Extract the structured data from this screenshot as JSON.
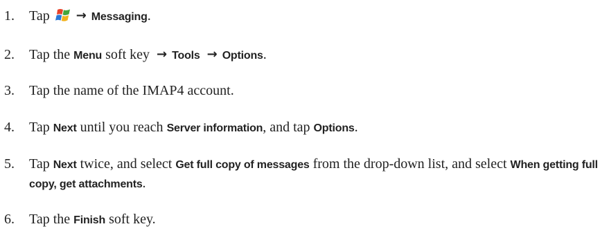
{
  "steps": [
    {
      "number": "1.",
      "parts": [
        {
          "t": "Tap ",
          "b": false
        },
        {
          "icon": "windows-start-icon"
        },
        {
          "arrow": "→"
        },
        {
          "t": "Messaging",
          "b": true
        },
        {
          "t": ".",
          "b": false
        }
      ]
    },
    {
      "number": "2.",
      "parts": [
        {
          "t": "Tap the ",
          "b": false
        },
        {
          "t": "Menu",
          "b": true
        },
        {
          "t": " soft key ",
          "b": false
        },
        {
          "arrow": "→"
        },
        {
          "t": "Tools",
          "b": true
        },
        {
          "t": " ",
          "b": false
        },
        {
          "arrow": "→"
        },
        {
          "t": "Options",
          "b": true
        },
        {
          "t": ".",
          "b": false
        }
      ]
    },
    {
      "number": "3.",
      "parts": [
        {
          "t": "Tap the name of the IMAP4 account.",
          "b": false
        }
      ]
    },
    {
      "number": "4.",
      "parts": [
        {
          "t": "Tap ",
          "b": false
        },
        {
          "t": "Next",
          "b": true
        },
        {
          "t": " until you reach ",
          "b": false
        },
        {
          "t": "Server information",
          "b": true
        },
        {
          "t": ", and tap ",
          "b": false
        },
        {
          "t": "Options",
          "b": true
        },
        {
          "t": ".",
          "b": false
        }
      ]
    },
    {
      "number": "5.",
      "parts": [
        {
          "t": "Tap ",
          "b": false
        },
        {
          "t": "Next",
          "b": true
        },
        {
          "t": " twice, and select ",
          "b": false
        },
        {
          "t": "Get full copy of messages",
          "b": true
        },
        {
          "t": " from the drop-down list, and select ",
          "b": false
        },
        {
          "t": "When getting full copy, get attachments",
          "b": true
        },
        {
          "t": ".",
          "b": false
        }
      ]
    },
    {
      "number": "6.",
      "parts": [
        {
          "t": "Tap the ",
          "b": false
        },
        {
          "t": "Finish",
          "b": true
        },
        {
          "t": " soft key.",
          "b": false
        }
      ]
    }
  ],
  "icons": {
    "start_icon_colors": [
      "#e8432a",
      "#44a63c",
      "#2a78d6",
      "#f2b21c"
    ]
  }
}
